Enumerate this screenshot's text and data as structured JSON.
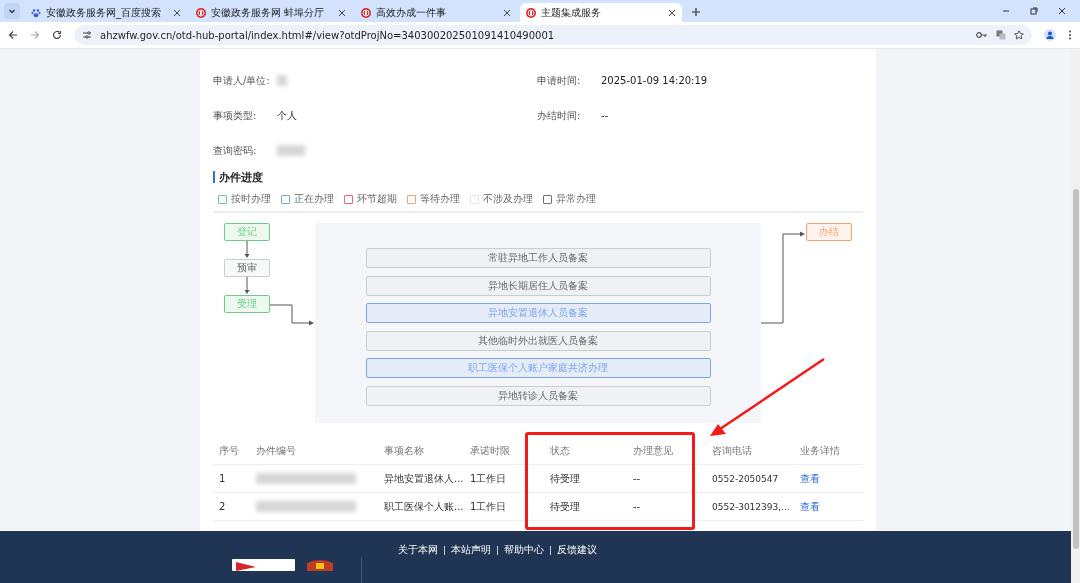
{
  "browser": {
    "tabs": [
      {
        "title": "安徽政务服务网_百度搜索",
        "kind": "paw",
        "selected": false
      },
      {
        "title": "安徽政务服务网 蚌埠分厅",
        "kind": "emblem",
        "selected": false
      },
      {
        "title": "高效办成一件事",
        "kind": "emblem",
        "selected": false
      },
      {
        "title": "主题集成服务",
        "kind": "emblem",
        "selected": true
      }
    ],
    "url": "ahzwfw.gov.cn/otd-hub-portal/index.html#/view?otdProjNo=340300202501091410490001"
  },
  "details": [
    {
      "label": "申请人/单位:",
      "redacted": true
    },
    {
      "label": "申请时间:",
      "value": "2025-01-09 14:20:19",
      "redacted": false
    },
    {
      "label": "事项类型:",
      "value": "个人",
      "redacted": false
    },
    {
      "label": "办结时间:",
      "value": "--",
      "redacted": false
    },
    {
      "label": "查询密码:",
      "redacted": true
    }
  ],
  "progress": {
    "title": "办件进度",
    "legend": [
      {
        "label": "按时办理",
        "color": "#6ccf85"
      },
      {
        "label": "正在办理",
        "color": "#79a6f2"
      },
      {
        "label": "环节超期",
        "color": "#e86a6a"
      },
      {
        "label": "等待办理",
        "color": "#f4a36f"
      },
      {
        "label": "不涉及办理",
        "color": "#e2e4e8"
      },
      {
        "label": "异常办理",
        "color": "#6b7280"
      }
    ],
    "steps": [
      {
        "label": "登记",
        "color": "#6ccf85"
      },
      {
        "label": "预审",
        "color": "#c9ccd2"
      },
      {
        "label": "受理",
        "color": "#6ccf85"
      }
    ],
    "items": [
      {
        "label": "常驻异地工作人员备案",
        "color": "#c9ccd2"
      },
      {
        "label": "异地长期居住人员备案",
        "color": "#c9ccd2"
      },
      {
        "label": "异地安置退休人员备案",
        "color": "#79a6f2"
      },
      {
        "label": "其他临时外出就医人员备案",
        "color": "#c9ccd2"
      },
      {
        "label": "职工医保个人账户家庭共济办理",
        "color": "#79a6f2"
      },
      {
        "label": "异地转诊人员备案",
        "color": "#c9ccd2"
      }
    ],
    "end": {
      "label": "办结",
      "color": "#f4a36f"
    }
  },
  "table": {
    "columns": [
      "序号",
      "办件编号",
      "事项名称",
      "承诺时限",
      "状态",
      "办理意见",
      "咨询电话",
      "业务详情"
    ],
    "rows": [
      {
        "index": "1",
        "name": "异地安置退休人...",
        "limit": "1工作日",
        "status": "待受理",
        "opinion": "--",
        "phone": "0552-2050547",
        "action": "查看"
      },
      {
        "index": "2",
        "name": "职工医保个人账...",
        "limit": "1工作日",
        "status": "待受理",
        "opinion": "--",
        "phone": "0552-3012393,...",
        "action": "查看"
      }
    ]
  },
  "footer": {
    "links": [
      "关于本网",
      "本站声明",
      "帮助中心",
      "反馈建议"
    ]
  }
}
